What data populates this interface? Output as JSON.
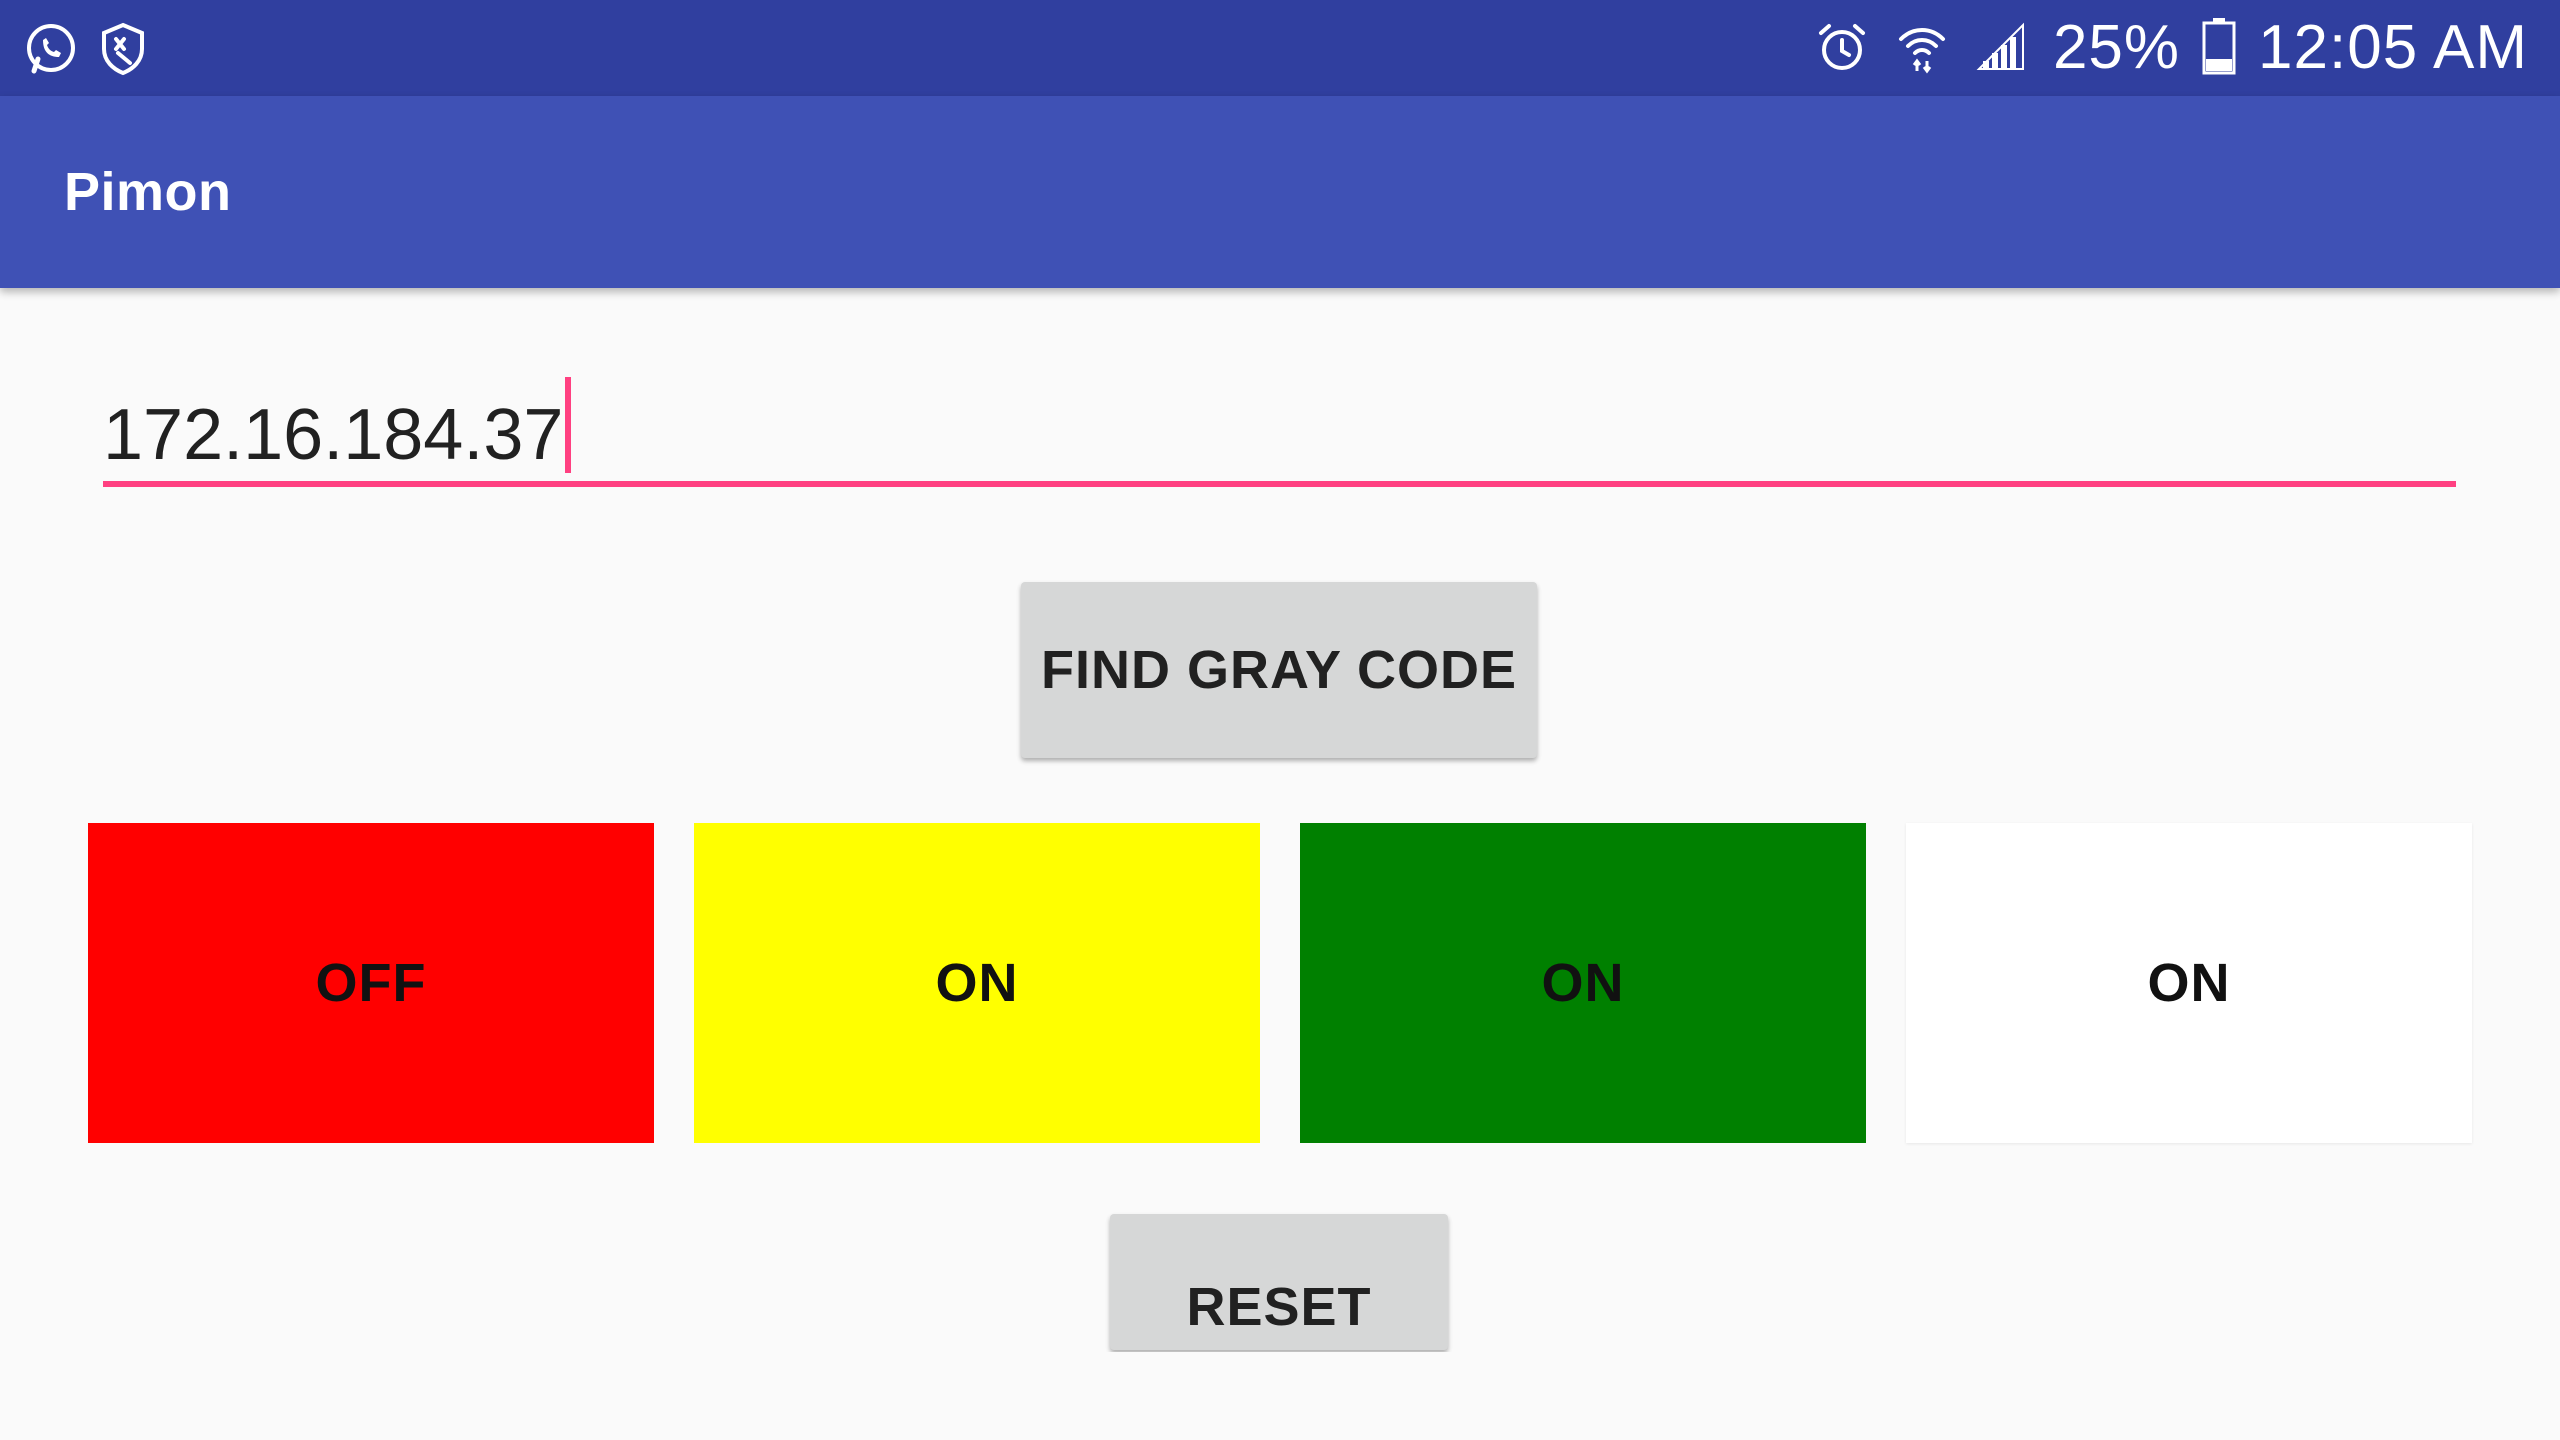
{
  "status_bar": {
    "left_icons": [
      "whatsapp-icon",
      "security-shield-icon"
    ],
    "right_icons": [
      "alarm-icon",
      "wifi-icon",
      "signal-icon"
    ],
    "battery_percent": "25%",
    "battery_level": 0.25,
    "time": "12:05 AM"
  },
  "app_bar": {
    "title": "Pimon"
  },
  "ip_field": {
    "value": "172.16.184.37"
  },
  "buttons": {
    "find_gray_code": "FIND GRAY CODE",
    "reset": "RESET"
  },
  "indicators": [
    {
      "label": "OFF",
      "color": "#ff0000"
    },
    {
      "label": "ON",
      "color": "#ffff00"
    },
    {
      "label": "ON",
      "color": "#008000"
    },
    {
      "label": "ON",
      "color": "#ffffff"
    }
  ],
  "colors": {
    "status_bar": "#303f9f",
    "app_bar": "#3f51b5",
    "accent": "#ff4081",
    "button_bg": "#d6d7d7",
    "background": "#fafafa"
  }
}
